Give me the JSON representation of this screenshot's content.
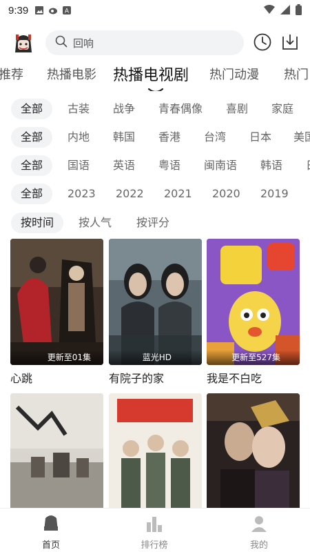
{
  "status_bar": {
    "time": "9:39",
    "left_icons": [
      "image-icon",
      "weibo-icon",
      "app-icon"
    ],
    "right_icons": [
      "wifi-icon",
      "signal-icon",
      "battery-icon"
    ]
  },
  "header": {
    "logo": "app-logo",
    "search_placeholder": "回响",
    "history_icon": "clock-icon",
    "download_icon": "download-icon"
  },
  "tabs": [
    {
      "label": "推荐",
      "active": false
    },
    {
      "label": "热播电影",
      "active": false
    },
    {
      "label": "热播电视剧",
      "active": true
    },
    {
      "label": "热门动漫",
      "active": false
    },
    {
      "label": "热门",
      "active": false
    }
  ],
  "filters": {
    "genre": [
      "全部",
      "古装",
      "战争",
      "青春偶像",
      "喜剧",
      "家庭"
    ],
    "region": [
      "全部",
      "内地",
      "韩国",
      "香港",
      "台湾",
      "日本",
      "美国"
    ],
    "language": [
      "全部",
      "国语",
      "英语",
      "粤语",
      "闽南语",
      "韩语",
      "日"
    ],
    "year": [
      "全部",
      "2023",
      "2022",
      "2021",
      "2020",
      "2019"
    ],
    "sort": [
      "按时间",
      "按人气",
      "按评分"
    ]
  },
  "cards": [
    {
      "title": "心跳",
      "badge": "更新至01集"
    },
    {
      "title": "有院子的家",
      "badge": "蓝光HD"
    },
    {
      "title": "我是不白吃",
      "badge": "更新至527集"
    },
    {
      "title": "",
      "badge": ""
    },
    {
      "title": "",
      "badge": ""
    },
    {
      "title": "",
      "badge": ""
    }
  ],
  "bottom_nav": [
    {
      "label": "首页",
      "icon": "home-icon",
      "active": true
    },
    {
      "label": "排行榜",
      "icon": "ranking-icon",
      "active": false
    },
    {
      "label": "我的",
      "icon": "profile-icon",
      "active": false
    }
  ],
  "colors": {
    "background": "#ffffff",
    "pill": "#f2f3f5",
    "text_primary": "#222222",
    "text_secondary": "#666666"
  }
}
